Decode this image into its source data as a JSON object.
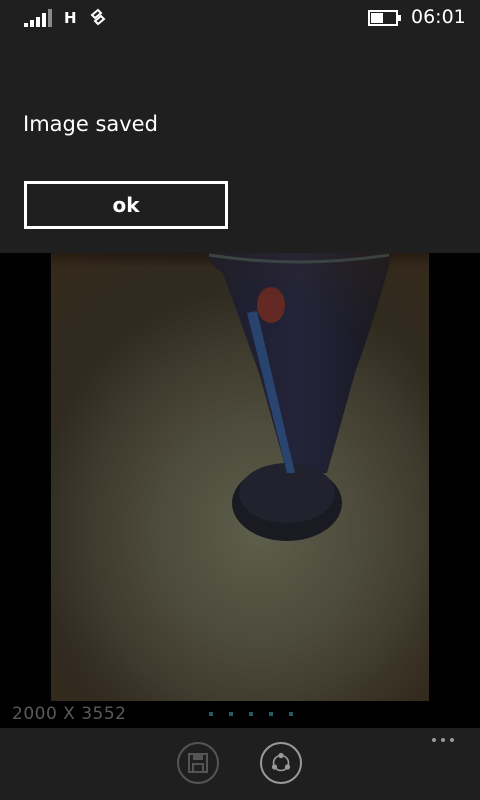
{
  "status_bar": {
    "signal_icon": "signal-bars-icon",
    "network_type": "H",
    "data_icon": "data-transfer-icon",
    "battery_icon": "battery-icon",
    "battery_level": 0.5,
    "time": "06:01"
  },
  "dialog": {
    "message": "Image saved",
    "ok_label": "ok"
  },
  "photo": {
    "resolution": "2000 X 3552",
    "page_dot_count": 5
  },
  "app_bar": {
    "buttons": [
      {
        "name": "save",
        "icon": "floppy-disk-icon",
        "enabled": false
      },
      {
        "name": "share",
        "icon": "share-icon",
        "enabled": true
      }
    ],
    "more_icon": "ellipsis-icon"
  },
  "colors": {
    "background": "#000000",
    "dialog_background": "#1f1f1f",
    "text": "#ffffff",
    "muted_text": "#5a5a5a",
    "accent_dot": "#1f5f63"
  }
}
